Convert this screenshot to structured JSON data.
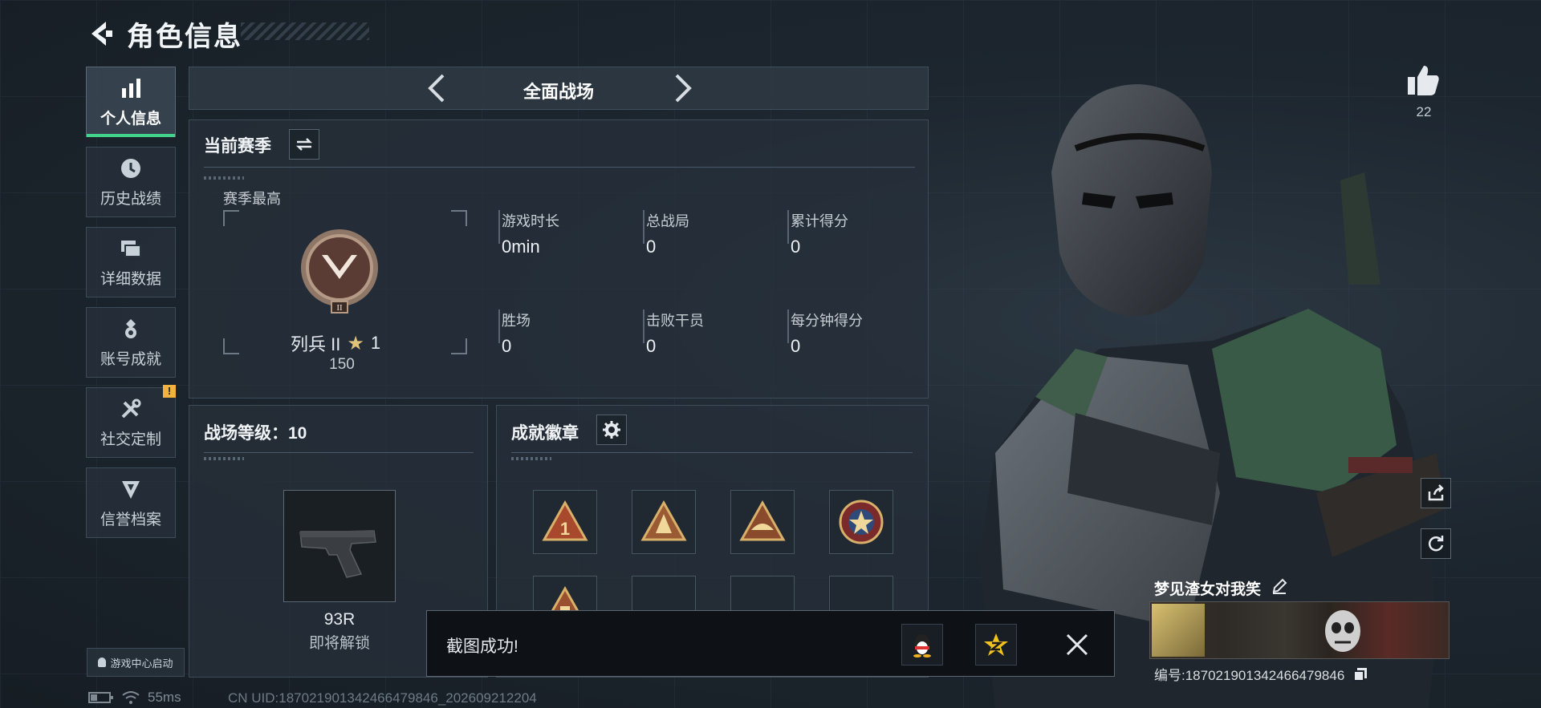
{
  "header": {
    "title": "角色信息"
  },
  "sidebar": {
    "items": [
      {
        "label": "个人信息",
        "icon": "bar-chart-icon"
      },
      {
        "label": "历史战绩",
        "icon": "clock-icon"
      },
      {
        "label": "详细数据",
        "icon": "folder-icon"
      },
      {
        "label": "账号成就",
        "icon": "medal-icon"
      },
      {
        "label": "社交定制",
        "icon": "tools-icon"
      },
      {
        "label": "信誉档案",
        "icon": "shield-icon"
      }
    ],
    "warning_badge": "!"
  },
  "game_center": {
    "label": "游戏中心启动"
  },
  "mode": {
    "name": "全面战场"
  },
  "season": {
    "title": "当前赛季",
    "best_label": "赛季最高",
    "rank_name": "列兵 II",
    "stars": "1",
    "rank_points": "150",
    "rank_roman": "II",
    "stats": [
      {
        "label": "游戏时长",
        "value": "0min"
      },
      {
        "label": "总战局",
        "value": "0"
      },
      {
        "label": "累计得分",
        "value": "0"
      },
      {
        "label": "胜场",
        "value": "0"
      },
      {
        "label": "击败干员",
        "value": "0"
      },
      {
        "label": "每分钟得分",
        "value": "0"
      }
    ]
  },
  "level": {
    "title": "战场等级：10",
    "weapon_name": "93R",
    "unlock_text": "即将解锁"
  },
  "achievements": {
    "title": "成就徽章",
    "badge_1_text": "1"
  },
  "toast": {
    "message": "截图成功!"
  },
  "likes": {
    "count": "22"
  },
  "profile": {
    "username": "梦见渣女对我笑",
    "id_text": "编号:18702190134246647984​6"
  },
  "status": {
    "ping": "55ms",
    "cn_uid": "CN UID:18702190134246647984​6_202609212204"
  },
  "colors": {
    "accent": "#44d38a",
    "warning": "#f3b23a"
  }
}
